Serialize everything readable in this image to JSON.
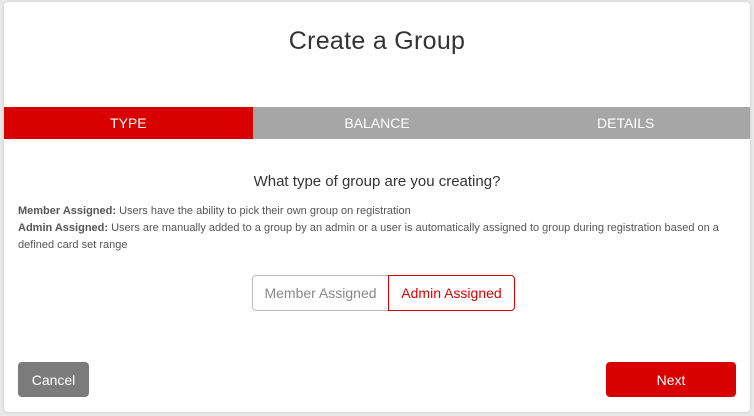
{
  "dialog": {
    "title": "Create a Group"
  },
  "steps": [
    {
      "label": "TYPE",
      "active": true
    },
    {
      "label": "BALANCE",
      "active": false
    },
    {
      "label": "DETAILS",
      "active": false
    }
  ],
  "content": {
    "question": "What type of group are you creating?",
    "descriptions": [
      {
        "term": "Member Assigned:",
        "text": " Users have the ability to pick their own group on registration"
      },
      {
        "term": "Admin Assigned:",
        "text": " Users are manually added to a group by an admin or a user is automatically assigned to group during registration based on a defined card set range"
      }
    ]
  },
  "type_toggle": {
    "options": [
      "Member Assigned",
      "Admin Assigned"
    ],
    "selected": "Admin Assigned"
  },
  "footer": {
    "cancel_label": "Cancel",
    "next_label": "Next"
  },
  "colors": {
    "accent": "#d90000",
    "step_inactive": "#a6a6a6",
    "cancel_bg": "#7b7b7b"
  }
}
